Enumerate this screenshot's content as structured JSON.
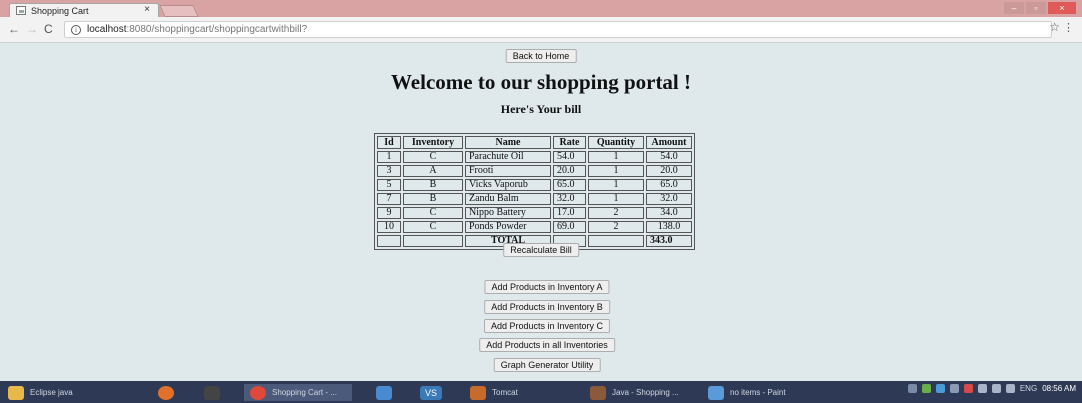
{
  "browser": {
    "tab_title": "Shopping Cart",
    "tab_close": "×",
    "url_host": "localhost",
    "url_path": ":8080/shoppingcart/shoppingcartwithbill?",
    "info_icon": "i",
    "back_glyph": "←",
    "forward_glyph": "→",
    "reload_glyph": "C",
    "star_glyph": "☆",
    "menu_glyph": "⋮",
    "min_glyph": "–",
    "max_glyph": "▫",
    "close_glyph": "×"
  },
  "page": {
    "back_home_label": "Back to Home",
    "heading": "Welcome to our shopping portal !",
    "subheading": "Here's Your bill",
    "table": {
      "headers": [
        "Id",
        "Inventory",
        "Name",
        "Rate",
        "Quantity",
        "Amount"
      ],
      "rows": [
        [
          "1",
          "C",
          "Parachute Oil",
          "54.0",
          "1",
          "54.0"
        ],
        [
          "3",
          "A",
          "Frooti",
          "20.0",
          "1",
          "20.0"
        ],
        [
          "5",
          "B",
          "Vicks Vaporub",
          "65.0",
          "1",
          "65.0"
        ],
        [
          "7",
          "B",
          "Zandu Balm",
          "32.0",
          "1",
          "32.0"
        ],
        [
          "9",
          "C",
          "Nippo Battery",
          "17.0",
          "2",
          "34.0"
        ],
        [
          "10",
          "C",
          "Ponds Powder",
          "69.0",
          "2",
          "138.0"
        ]
      ],
      "total_label": "TOTAL",
      "total_amount": "343.0"
    },
    "recalc_label": "Recalculate Bill",
    "add_a_label": "Add Products in Inventory A",
    "add_b_label": "Add Products in Inventory B",
    "add_c_label": "Add Products in Inventory C",
    "add_all_label": "Add Products in all Inventories",
    "graph_label": "Graph Generator Utility"
  },
  "taskbar": {
    "items": [
      {
        "label": "Eclipse java",
        "color": "#e8b84a"
      },
      {
        "label": "",
        "color": "#e0702a"
      },
      {
        "label": "",
        "color": "#444444"
      },
      {
        "label": "Shopping Cart - ...",
        "color": "#e0483a"
      },
      {
        "label": "",
        "color": "#4a8ad0"
      },
      {
        "label": "",
        "color": "#3a7ab8"
      },
      {
        "label": "Tomcat",
        "color": "#c86a2a"
      },
      {
        "label": "Java - Shopping ...",
        "color": "#8a5a3a"
      },
      {
        "label": "no items - Paint",
        "color": "#5a9ad8"
      }
    ],
    "vs_label": "VS",
    "lang": "ENG",
    "time": "08:56 AM"
  },
  "colors": {
    "titlebar": "#d9a3a3",
    "page_bg": "#dfe9ec",
    "taskbar": "#2e3a55"
  }
}
